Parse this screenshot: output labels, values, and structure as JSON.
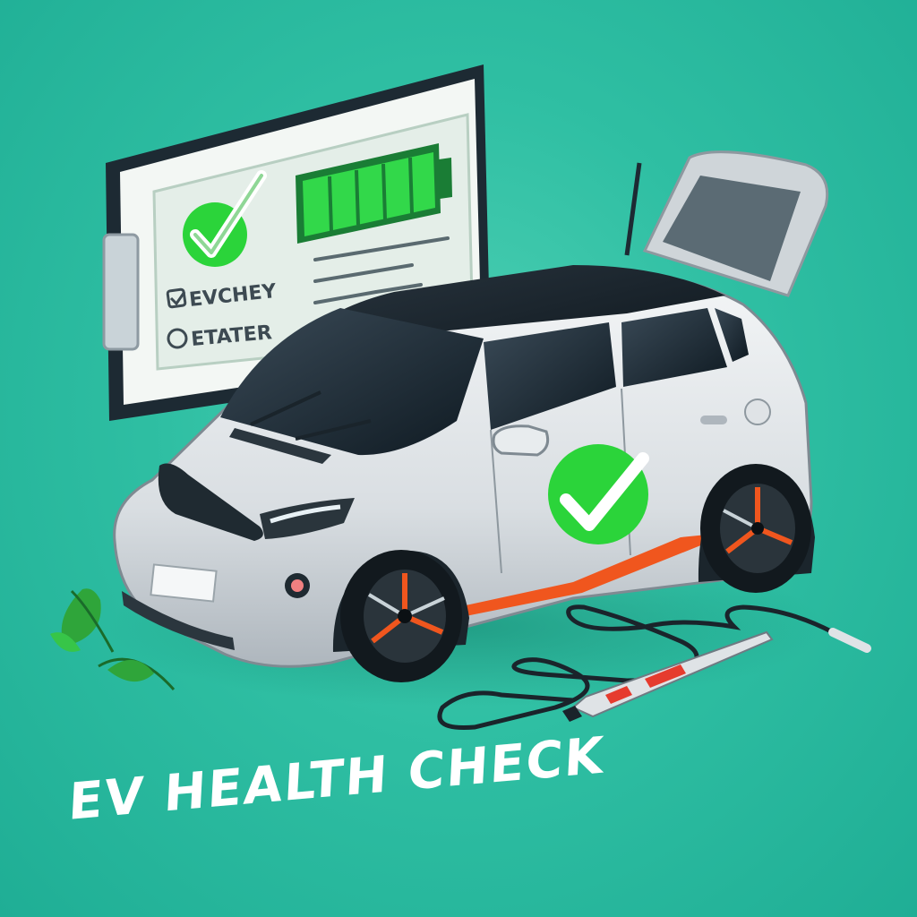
{
  "clipboard": {
    "item_checked_label": "EVCHEY",
    "item_unchecked_label": "ETATER",
    "battery_charge_fraction": 1.0
  },
  "car": {
    "door_badge_icon": "checkmark-icon"
  },
  "caption": {
    "text": "EV HEALTH CHECK"
  },
  "colors": {
    "background": "#2fbfa3",
    "check_green": "#2bd43a",
    "battery_green": "#32d84a",
    "car_body": "#dfe3e6",
    "accent_orange": "#f0561e",
    "leaf_green": "#2fa53a"
  }
}
